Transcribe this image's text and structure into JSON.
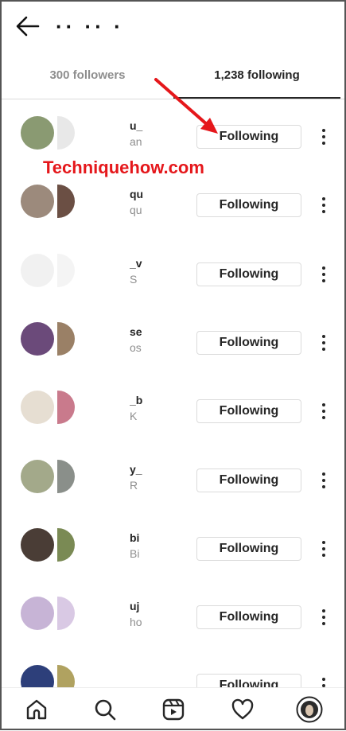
{
  "header": {
    "title": "·· ·· ·"
  },
  "tabs": {
    "followers_label": "300 followers",
    "following_label": "1,238 following"
  },
  "watermark": "Techniquehow.com",
  "colors": {
    "accent": "#e5171b",
    "text": "#262626",
    "muted": "#8e8e8e",
    "border": "#dbdbdb"
  },
  "rows": [
    {
      "username": "u_",
      "subtitle": "an",
      "button": "Following",
      "avatar_color": "#8a9a72",
      "avatar_color2": "#e8e8e8"
    },
    {
      "username": "qu",
      "subtitle": "qu",
      "button": "Following",
      "avatar_color": "#9c8a7c",
      "avatar_color2": "#6b4f44"
    },
    {
      "username": "_v",
      "subtitle": "S",
      "button": "Following",
      "avatar_color": "#f1f1f1",
      "avatar_color2": "#f4f4f4"
    },
    {
      "username": "se",
      "subtitle": "os",
      "button": "Following",
      "avatar_color": "#6b4a7a",
      "avatar_color2": "#9a8066"
    },
    {
      "username": "_b",
      "subtitle": "K",
      "button": "Following",
      "avatar_color": "#e6ded2",
      "avatar_color2": "#c97a8c"
    },
    {
      "username": "y_",
      "subtitle": "R",
      "button": "Following",
      "avatar_color": "#a3a98a",
      "avatar_color2": "#8a8f8a"
    },
    {
      "username": "bi",
      "subtitle": "Bi",
      "button": "Following",
      "avatar_color": "#4a3d36",
      "avatar_color2": "#7a8a54"
    },
    {
      "username": "uj",
      "subtitle": "ho",
      "button": "Following",
      "avatar_color": "#c7b4d6",
      "avatar_color2": "#d9c9e4"
    },
    {
      "username": "",
      "subtitle": "",
      "button": "Following",
      "avatar_color": "#2d3f7a",
      "avatar_color2": "#b0a260"
    }
  ],
  "nav": [
    "home-icon",
    "search-icon",
    "reels-icon",
    "heart-icon",
    "profile-avatar"
  ]
}
